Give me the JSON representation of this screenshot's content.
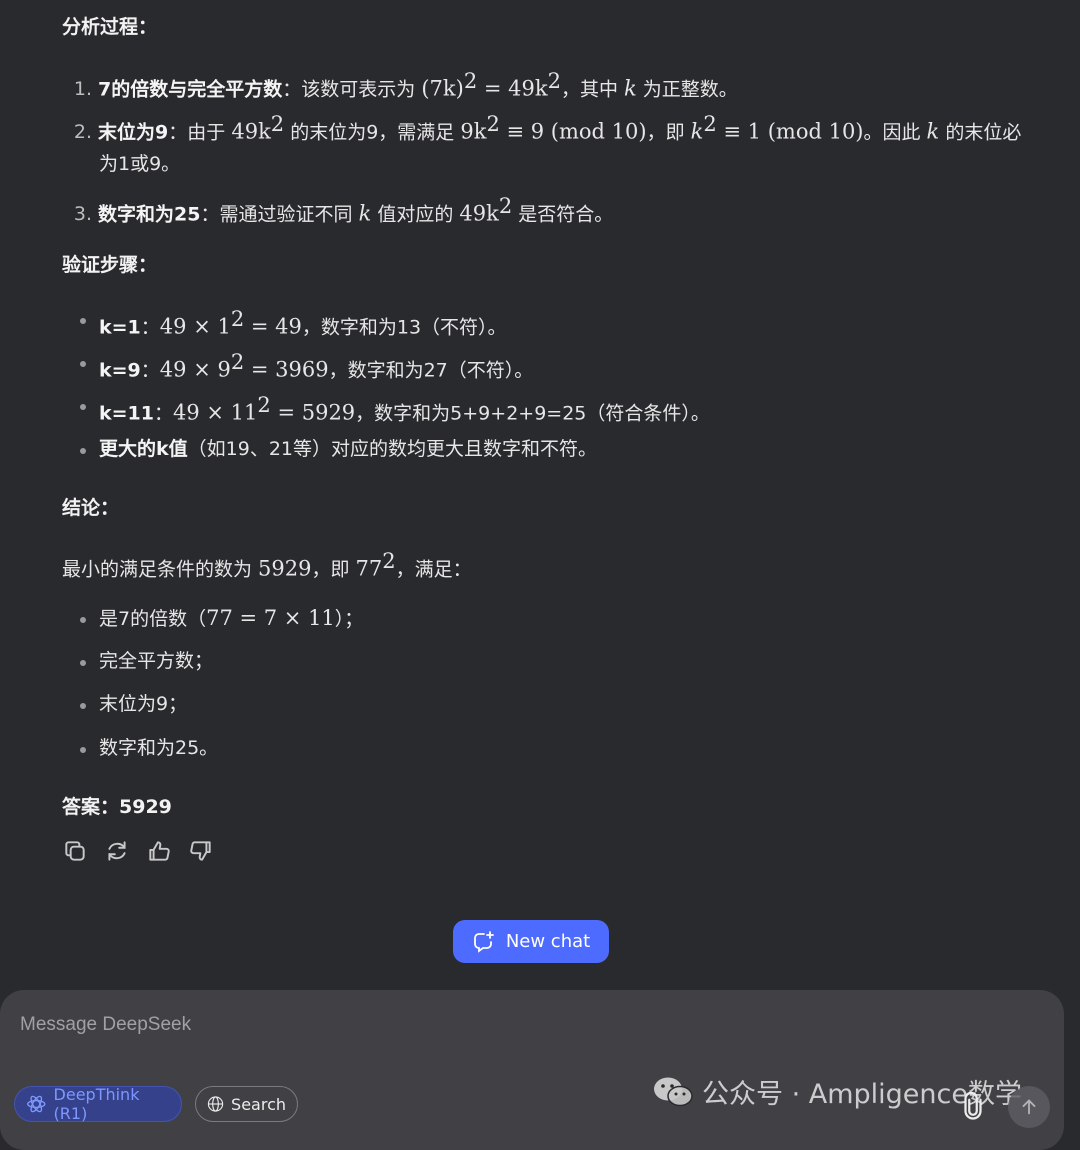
{
  "answer": {
    "analysis_heading": "分析过程：",
    "analysis_items": [
      {
        "num": "1.",
        "bold": "7的倍数与完全平方数",
        "sep": "：",
        "t1": "该数可表示为 ",
        "m1": "(7k)",
        "s1": "2",
        "m2": " = 49k",
        "s2": "2",
        "t2": "，其中 ",
        "m3": "k",
        "t3": " 为正整数。"
      },
      {
        "num": "2.",
        "bold": "末位为9",
        "sep": "：",
        "t1": "由于 ",
        "m1": "49k",
        "s1": "2",
        "t2": " 的末位为9，需满足 ",
        "m2": "9k",
        "s2": "2",
        "m3": " ≡ 9 (mod 10)",
        "t3": "，即 ",
        "m4": "k",
        "s3": "2",
        "m5": " ≡ 1 (mod 10)",
        "t4": "。因此 ",
        "m6": "k",
        "t5": " 的末位必",
        "t6": "为1或9。"
      },
      {
        "num": "3.",
        "bold": "数字和为25",
        "sep": "：",
        "t1": "需通过验证不同 ",
        "m1": "k",
        "t2": " 值对应的 ",
        "m2": "49k",
        "s1": "2",
        "t3": " 是否符合。"
      }
    ],
    "verify_heading": "验证步骤：",
    "verify_items": [
      {
        "bold": "k=1",
        "sep": "：",
        "m1": "49 × 1",
        "s1": "2",
        "m2": " = 49",
        "t1": "，数字和为13（不符）。"
      },
      {
        "bold": "k=9",
        "sep": "：",
        "m1": "49 × 9",
        "s1": "2",
        "m2": " = 3969",
        "t1": "，数字和为27（不符）。"
      },
      {
        "bold": "k=11",
        "sep": "：",
        "m1": "49 × 11",
        "s1": "2",
        "m2": " = 5929",
        "t1": "，数字和为5+9+2+9=25（符合条件）。"
      },
      {
        "bold": "更大的k值",
        "t1": "（如19、21等）对应的数均更大且数字和不符。"
      }
    ],
    "conclusion_heading": "结论：",
    "conclusion_text": {
      "t1": "最小的满足条件的数为 ",
      "m1": "5929",
      "t2": "，即 ",
      "m2": "77",
      "s1": "2",
      "t3": "，满足："
    },
    "conclusion_items": [
      {
        "t1": "是7的倍数（",
        "m1": "77 = 7 × 11",
        "t2": "）；"
      },
      {
        "t1": "完全平方数；"
      },
      {
        "t1": "末位为9；"
      },
      {
        "t1": "数字和为25。"
      }
    ],
    "final_answer": "答案：5929"
  },
  "actions": [
    {
      "icon": "copy-icon"
    },
    {
      "icon": "regenerate-icon"
    },
    {
      "icon": "thumbs-up-icon"
    },
    {
      "icon": "thumbs-down-icon"
    }
  ],
  "new_chat": {
    "label": "New chat",
    "icon": "new-chat-icon",
    "color": "#4d6bfe"
  },
  "composer": {
    "placeholder": "Message DeepSeek",
    "deepthink_label": "DeepThink (R1)",
    "search_label": "Search"
  },
  "watermark": "公众号 · Ampligence数学"
}
